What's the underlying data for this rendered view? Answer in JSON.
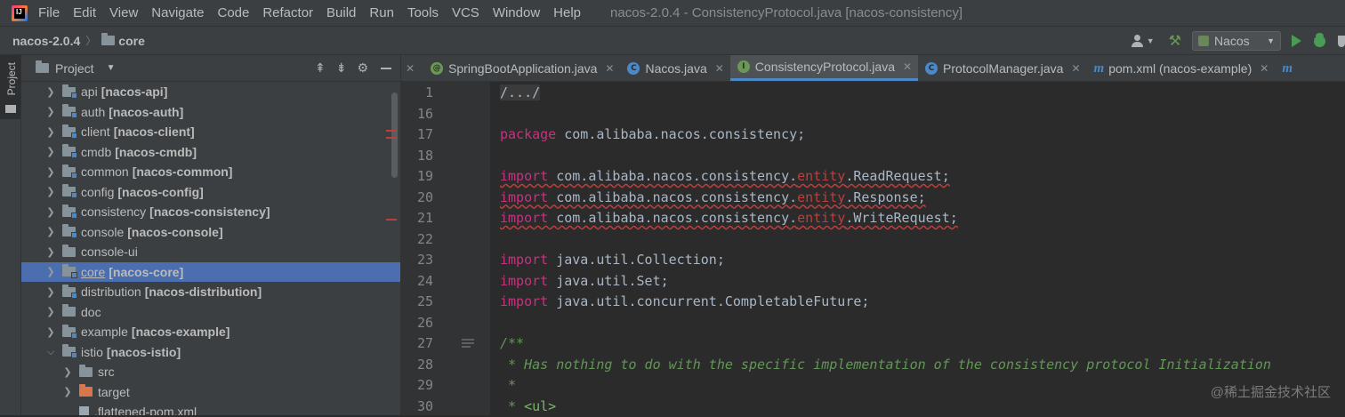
{
  "menubar": {
    "items": [
      "File",
      "Edit",
      "View",
      "Navigate",
      "Code",
      "Refactor",
      "Build",
      "Run",
      "Tools",
      "VCS",
      "Window",
      "Help"
    ],
    "window_title": "nacos-2.0.4 - ConsistencyProtocol.java [nacos-consistency]"
  },
  "navbar": {
    "project": "nacos-2.0.4",
    "folder": "core",
    "run_config": "Nacos"
  },
  "tool_strip": {
    "label": "Project"
  },
  "project_panel": {
    "title": "Project",
    "tree": [
      {
        "name": "api",
        "module": "[nacos-api]"
      },
      {
        "name": "auth",
        "module": "[nacos-auth]"
      },
      {
        "name": "client",
        "module": "[nacos-client]"
      },
      {
        "name": "cmdb",
        "module": "[nacos-cmdb]"
      },
      {
        "name": "common",
        "module": "[nacos-common]"
      },
      {
        "name": "config",
        "module": "[nacos-config]"
      },
      {
        "name": "consistency",
        "module": "[nacos-consistency]"
      },
      {
        "name": "console",
        "module": "[nacos-console]"
      },
      {
        "name": "console-ui",
        "module": ""
      },
      {
        "name": "core",
        "module": "[nacos-core]"
      },
      {
        "name": "distribution",
        "module": "[nacos-distribution]"
      },
      {
        "name": "doc",
        "module": ""
      },
      {
        "name": "example",
        "module": "[nacos-example]"
      },
      {
        "name": "istio",
        "module": "[nacos-istio]"
      },
      {
        "name": "src",
        "module": ""
      },
      {
        "name": "target",
        "module": ""
      },
      {
        "name": ".flattened-pom.xml",
        "module": ""
      }
    ]
  },
  "tabs": [
    {
      "label": "SpringBootApplication.java",
      "icon": "annotation-icon"
    },
    {
      "label": "Nacos.java",
      "icon": "class-icon"
    },
    {
      "label": "ConsistencyProtocol.java",
      "icon": "interface-icon"
    },
    {
      "label": "ProtocolManager.java",
      "icon": "class-icon"
    },
    {
      "label": "pom.xml (nacos-example)",
      "icon": "maven-icon"
    }
  ],
  "editor": {
    "line_numbers": [
      "1",
      "16",
      "17",
      "18",
      "19",
      "20",
      "21",
      "22",
      "23",
      "24",
      "25",
      "26",
      "27",
      "28",
      "29",
      "30"
    ],
    "folded": "/.../",
    "kw_package": "package",
    "kw_import": "import",
    "package_name": "com.alibaba.nacos.consistency",
    "entity_prefix": "com.alibaba.nacos.consistency.",
    "entity_seg": "entity",
    "read_request": "ReadRequest",
    "response": "Response",
    "write_request": "WriteRequest",
    "java_util": "java.util.",
    "collection": "Collection",
    "set": "Set",
    "java_util_concurrent": "java.util.concurrent.",
    "completable_future": "CompletableFuture",
    "semicolon": ";",
    "dot": ".",
    "doc_open": "/**",
    "doc_line1": " * Has nothing to do with the specific implementation of the consistency protocol Initialization",
    "doc_line2": " *",
    "doc_line3_prefix": " * ",
    "doc_line3_tag": "<ul>"
  },
  "watermark": "@稀土掘金技术社区"
}
